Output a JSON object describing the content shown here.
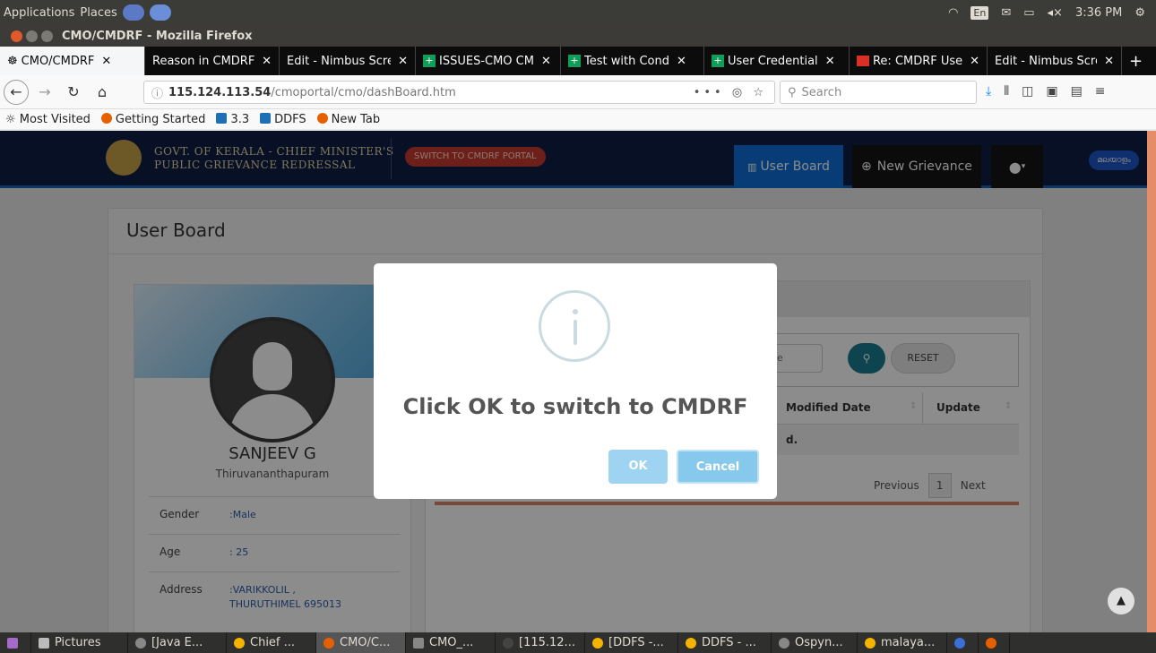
{
  "os_panel": {
    "applications": "Applications",
    "places": "Places",
    "lang": "En",
    "clock": "3:36 PM"
  },
  "window": {
    "title": "CMO/CMDRF - Mozilla Firefox"
  },
  "tabs": [
    {
      "label": "CMO/CMDRF",
      "icon": "site-icon"
    },
    {
      "label": "Reason in CMDRF ."
    },
    {
      "label": "Edit - Nimbus Scre"
    },
    {
      "label": "ISSUES-CMO CM",
      "icon": "sheets-icon"
    },
    {
      "label": "Test with Cond",
      "icon": "sheets-icon"
    },
    {
      "label": "User Credential",
      "icon": "sheets-icon"
    },
    {
      "label": "Re: CMDRF Use",
      "icon": "gmail-icon"
    },
    {
      "label": "Edit - Nimbus Scre"
    }
  ],
  "urlbar": {
    "host": "115.124.113.54",
    "path": "/cmoportal/cmo/dashBoard.htm",
    "actions": "••• ◎ ☆"
  },
  "searchbar": {
    "placeholder": "Search"
  },
  "bookmarks": [
    {
      "label": "Most Visited"
    },
    {
      "label": "Getting Started"
    },
    {
      "label": "3.3"
    },
    {
      "label": "DDFS"
    },
    {
      "label": "New Tab"
    }
  ],
  "site": {
    "title_line1": "GOVT. OF KERALA -  CHIEF MINISTER'S",
    "title_line2": "PUBLIC GRIEVANCE REDRESSAL",
    "switch_label": "SWITCH TO CMDRF PORTAL",
    "nav_userboard": "User Board",
    "nav_newgrievance": "New Grievance",
    "lang_button": "മലയാളം"
  },
  "page": {
    "title": "User Board",
    "profile": {
      "name": "SANJEEV G",
      "district": "Thiruvananthapuram",
      "rows": [
        {
          "key": "Gender",
          "value": ":Male"
        },
        {
          "key": "Age",
          "value": ": 25"
        },
        {
          "key": "Address",
          "value": ":VARIKKOLIL ,\nTHURUTHIMEL 695013"
        }
      ]
    },
    "filter": {
      "search_fragment": "e",
      "reset_label": "RESET"
    },
    "table": {
      "headers": [
        "Modified Date",
        "Update"
      ],
      "empty_fragment": "d."
    },
    "pager": {
      "previous": "Previous",
      "page": "1",
      "next": "Next"
    }
  },
  "modal": {
    "message": "Click OK to switch to CMDRF",
    "ok_label": "OK",
    "cancel_label": "Cancel"
  },
  "taskbar": [
    {
      "label": "Pictures"
    },
    {
      "label": "[Java E..."
    },
    {
      "label": "Chief ..."
    },
    {
      "label": "CMO/C..."
    },
    {
      "label": "CMO_..."
    },
    {
      "label": "[115.12..."
    },
    {
      "label": "[DDFS -..."
    },
    {
      "label": "DDFS - ..."
    },
    {
      "label": "Ospyn..."
    },
    {
      "label": "malaya..."
    }
  ]
}
